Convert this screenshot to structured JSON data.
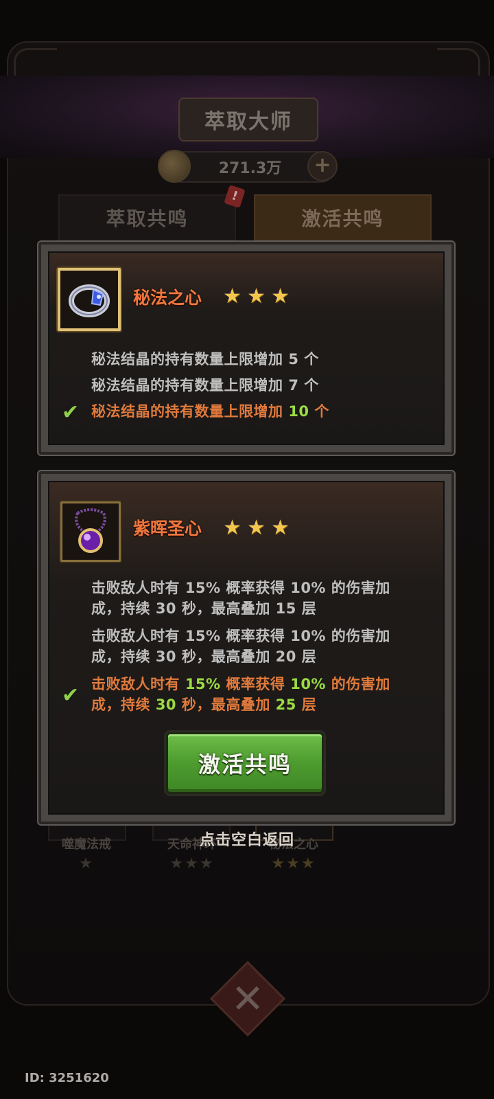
{
  "header": {
    "title": "萃取大师",
    "currency_amount": "271.3万"
  },
  "tabs": [
    {
      "label": "萃取共鸣"
    },
    {
      "label": "激活共鸣"
    }
  ],
  "badge": "!",
  "panels": [
    {
      "name": "秘法之心",
      "stars": 3,
      "effects": [
        {
          "text": "秘法结晶的持有数量上限增加",
          "value": "5",
          "unit": "个",
          "active": false
        },
        {
          "text": "秘法结晶的持有数量上限增加",
          "value": "7",
          "unit": "个",
          "active": false
        },
        {
          "text": "秘法结晶的持有数量上限增加",
          "value": "10",
          "unit": "个",
          "active": true
        }
      ]
    },
    {
      "name": "紫晖圣心",
      "stars": 3,
      "effects": [
        {
          "p1": "击败敌人时有",
          "chance": "15%",
          "p2": "概率获得",
          "bonus": "10%",
          "p3": "的伤害加",
          "p4": "成，持续",
          "duration": "30",
          "p5": "秒，最高叠加",
          "stacks": "15",
          "p6": "层",
          "active": false
        },
        {
          "p1": "击败敌人时有",
          "chance": "15%",
          "p2": "概率获得",
          "bonus": "10%",
          "p3": "的伤害加",
          "p4": "成，持续",
          "duration": "30",
          "p5": "秒，最高叠加",
          "stacks": "20",
          "p6": "层",
          "active": false
        },
        {
          "p1": "击败敌人时有",
          "chance": "15%",
          "p2": "概率获得",
          "bonus": "10%",
          "p3": "的伤害加",
          "p4": "成，持续",
          "duration": "30",
          "p5": "秒，最高叠加",
          "stacks": "25",
          "p6": "层",
          "active": true
        }
      ],
      "button_label": "激活共鸣"
    }
  ],
  "hint": "点击空白返回",
  "background_items": [
    {
      "label": "噬魔法戒"
    },
    {
      "label": "天命神环"
    },
    {
      "label": "秘法之心"
    }
  ],
  "footer_id": "ID: 3251620",
  "colors": {
    "accent_orange": "#f0773e",
    "highlight_green": "#9bdc42",
    "button_green": "#4f9e30"
  },
  "icons": [
    "star-icon",
    "check-icon",
    "ring-icon",
    "amulet-icon",
    "coin-icon",
    "plus-icon",
    "close-icon"
  ]
}
